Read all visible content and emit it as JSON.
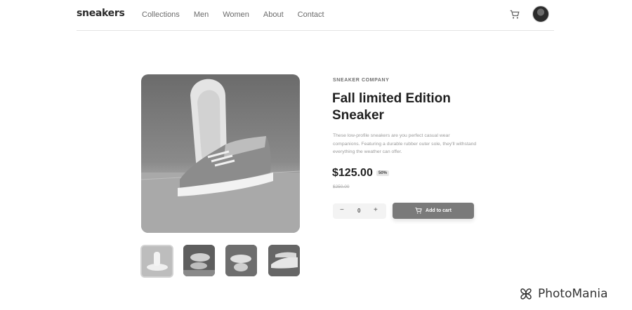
{
  "header": {
    "logo": "sneakers",
    "nav": [
      "Collections",
      "Men",
      "Women",
      "About",
      "Contact"
    ],
    "cart_icon": "cart-icon",
    "avatar_icon": "avatar"
  },
  "product": {
    "company": "SNEAKER COMPANY",
    "title": "Fall limited Edition Sneaker",
    "description": "These low-profile sneakers are you perfect casual wear companions. Featuring a durable rubber outer sole, they'll withstand everything the weather can offer.",
    "price": "$125.00",
    "discount": "50%",
    "old_price": "$250.00",
    "quantity": "0",
    "minus": "−",
    "plus": "+",
    "add_to_cart": "Add to cart"
  },
  "gallery": {
    "thumbnails": 4,
    "active_thumbnail": 1
  },
  "watermark": "PhotoMania",
  "colors": {
    "accent_button": "#7a7a7a",
    "text_dark": "#1f1f1f"
  }
}
